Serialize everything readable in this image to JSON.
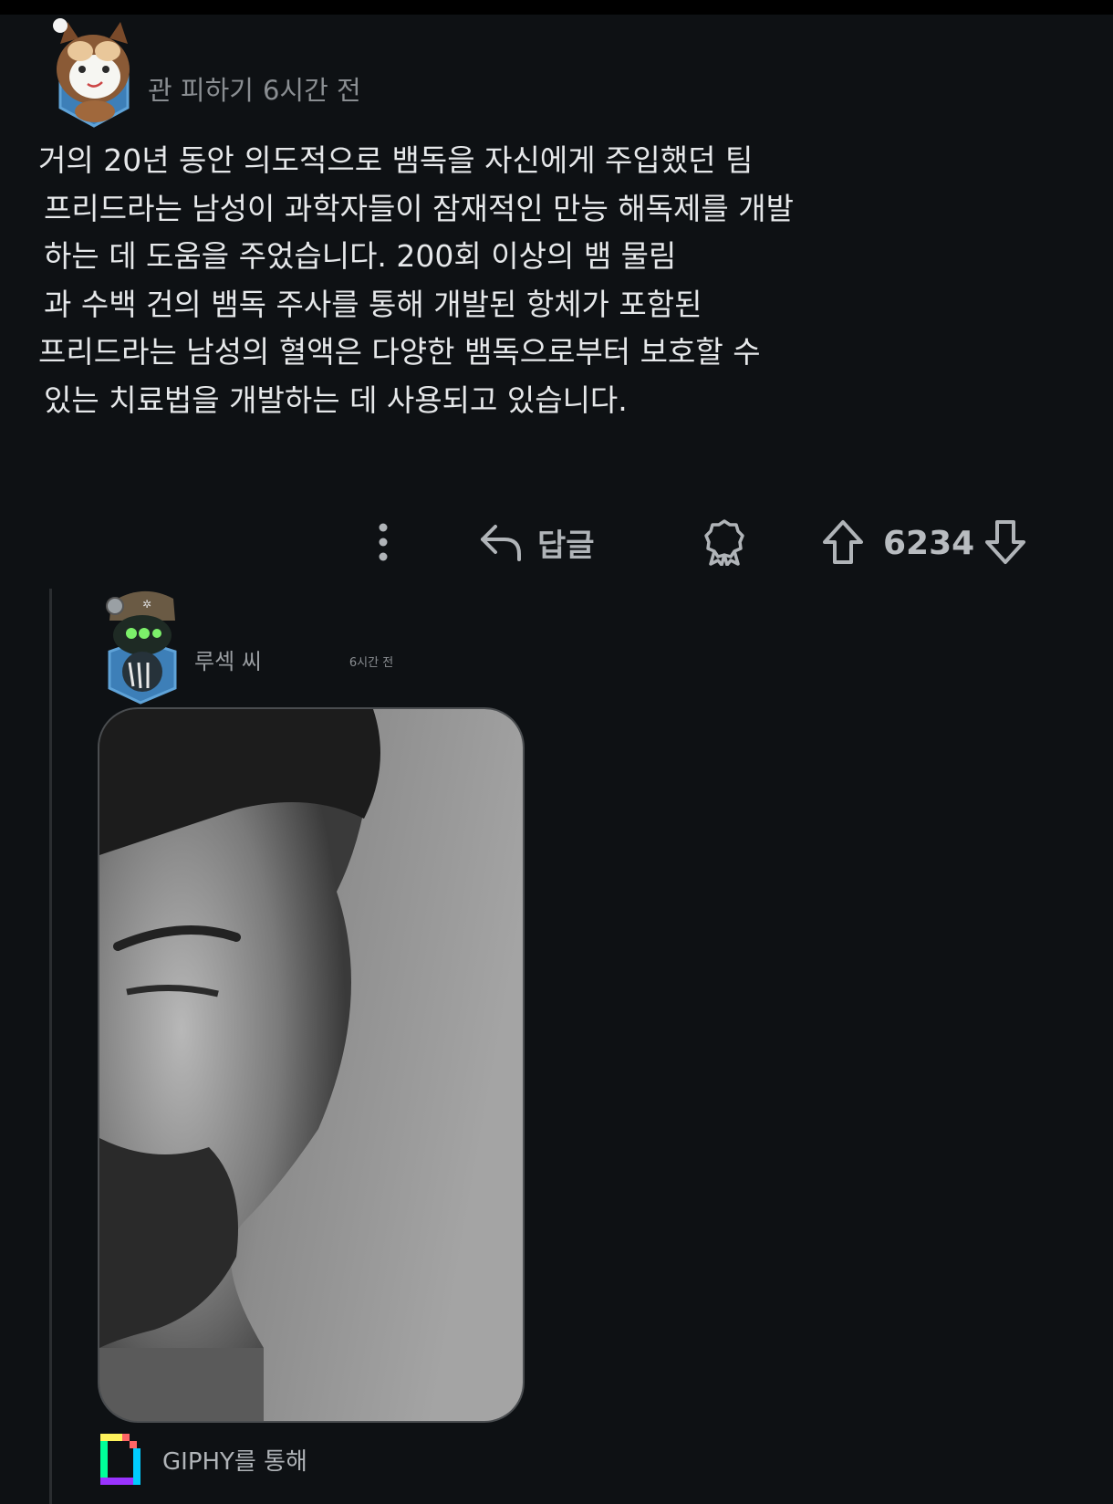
{
  "parent": {
    "username": "관 피하기",
    "time": "6시간 전",
    "body_lines": [
      "거의 20년 동안 의도적으로 뱀독을 자신에게 주입했던 팀",
      "프리드라는 남성이 과학자들이 잠재적인 만능 해독제를 개발",
      "하는 데 도움을 주었습니다. 200회 이상의 뱀 물림",
      "과 수백 건의 뱀독 주사를 통해 개발된 항체가 포함된",
      "프리드라는 남성의 혈액은 다양한 뱀독으로부터 보호할 수",
      "있는 치료법을 개발하는 데 사용되고 있습니다."
    ]
  },
  "actions": {
    "reply_label": "답글",
    "score": "6234",
    "icons": [
      "more-vertical-icon",
      "reply-arrow-icon",
      "award-icon",
      "upvote-arrow-icon",
      "downvote-arrow-icon"
    ]
  },
  "reply": {
    "username": "루섹 씨",
    "time": "6시간 전",
    "attribution": "GIPHY를 통해"
  },
  "colors": {
    "background": "#0e1114",
    "text": "#e6e8ea",
    "muted": "#8a8e92"
  }
}
